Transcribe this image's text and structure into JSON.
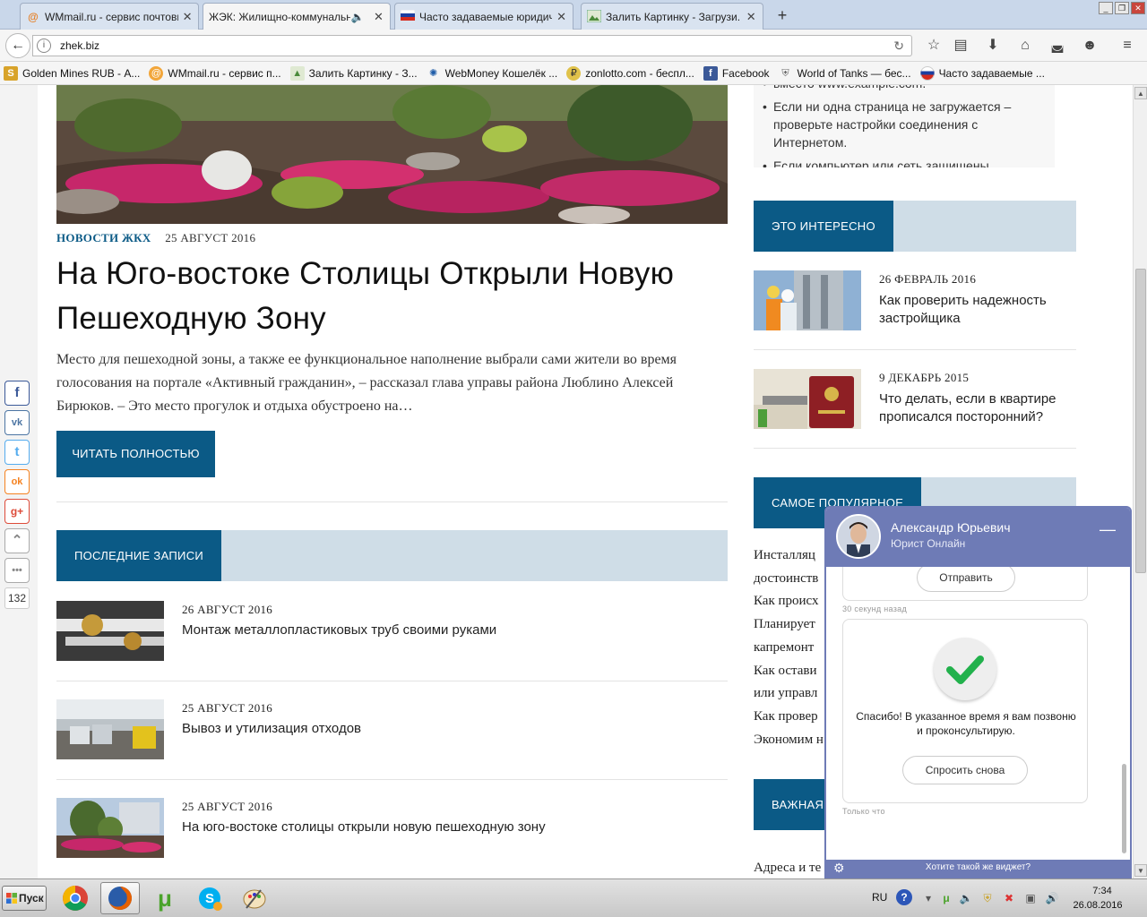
{
  "browser": {
    "tabs": [
      {
        "title": "WMmail.ru - сервис почтовых ...",
        "icon": "wmmail-icon",
        "active": false
      },
      {
        "title": "ЖЭК: Жилищно-коммунальн...",
        "icon": "zhek-icon",
        "active": true
      },
      {
        "title": "Часто задаваемые юридич...",
        "icon": "russia-flag-icon",
        "active": false
      },
      {
        "title": "Залить Картинку - Загрузи...",
        "icon": "image-upload-icon",
        "active": false
      }
    ],
    "new_tab_label": "+",
    "url": "zhek.biz",
    "bookmarks": [
      {
        "label": "Golden Mines RUB - А...",
        "icon": "golden-mines-icon"
      },
      {
        "label": "WMmail.ru - сервис п...",
        "icon": "wmmail-icon"
      },
      {
        "label": "Залить Картинку - З...",
        "icon": "image-upload-icon"
      },
      {
        "label": "WebMoney Кошелёк ...",
        "icon": "webmoney-icon"
      },
      {
        "label": "zonlotto.com - беспл...",
        "icon": "zonlotto-icon"
      },
      {
        "label": "Facebook",
        "icon": "facebook-icon"
      },
      {
        "label": "World of Tanks — бес...",
        "icon": "wot-icon"
      },
      {
        "label": "Часто задаваемые ...",
        "icon": "russia-flag-icon"
      }
    ]
  },
  "share": {
    "buttons": [
      {
        "name": "facebook",
        "glyph": "f",
        "color": "#3b5998"
      },
      {
        "name": "vkontakte",
        "glyph": "vk",
        "color": "#4c75a3"
      },
      {
        "name": "twitter",
        "glyph": "t",
        "color": "#55acee"
      },
      {
        "name": "odnoklassniki",
        "glyph": "ok",
        "color": "#f58220"
      },
      {
        "name": "google-plus",
        "glyph": "g+",
        "color": "#dd4b39"
      },
      {
        "name": "scroll-top",
        "glyph": "⌃",
        "color": "#888888"
      },
      {
        "name": "more",
        "glyph": "•••",
        "color": "#888888"
      }
    ],
    "count": "132"
  },
  "article": {
    "category": "НОВОСТИ ЖКХ",
    "date": "25 АВГУСТ 2016",
    "title": "На Юго-востоке Столицы Открыли Новую Пешеходную Зону",
    "excerpt": "Место для пешеходной зоны, а также ее функциональное наполнение выбрали сами жители во время голосования на портале «Активный гражданин», – рассказал глава управы района Люблино Алексей Бирюков. – Это место прогулок и отдыха обустроено на…",
    "read_more": "ЧИТАТЬ ПОЛНОСТЬЮ"
  },
  "latest": {
    "heading": "ПОСЛЕДНИЕ ЗАПИСИ",
    "posts": [
      {
        "date": "26 АВГУСТ 2016",
        "title": "Монтаж металлопластиковых труб своими руками"
      },
      {
        "date": "25 АВГУСТ 2016",
        "title": "Вывоз и утилизация отходов"
      },
      {
        "date": "25 АВГУСТ 2016",
        "title": "На юго-востоке столицы открыли новую пешеходную зону"
      }
    ]
  },
  "sidebar": {
    "notice_items": [
      "вместо www.example.com.",
      "Если ни одна страница не загружается – проверьте настройки соединения с Интернетом.",
      "Если компьютер или сеть защищены"
    ],
    "interesting_heading": "ЭТО ИНТЕРЕСНО",
    "interesting": [
      {
        "date": "26 ФЕВРАЛЬ 2016",
        "title": "Как проверить надежность застройщика"
      },
      {
        "date": "9 ДЕКАБРЬ 2015",
        "title": "Что делать, если в квартире прописался посторонний?"
      }
    ],
    "popular_heading": "САМОЕ ПОПУЛЯРНОЕ",
    "popular_lines": [
      "Инсталляц",
      "достоинств",
      "Как происх",
      "Планирует",
      "капремонт",
      "Как остави",
      "или управл",
      "Как провер",
      "Экономим н"
    ],
    "important_heading": "ВАЖНАЯ",
    "address_text": "Адреса и те"
  },
  "chat": {
    "name": "Александр Юрьевич",
    "role": "Юрист Онлайн",
    "minimize": "—",
    "send_label": "Отправить",
    "time_1": "30 секунд назад",
    "thanks": "Спасибо! В указанное время я вам позвоню и проконсультирую.",
    "ask_again": "Спросить снова",
    "time_2": "Только что",
    "footer_link": "Хотите такой же виджет?"
  },
  "taskbar": {
    "start_label": "Пуск",
    "apps": [
      {
        "name": "chrome",
        "glyph": "◉",
        "color": "#db4437"
      },
      {
        "name": "firefox",
        "glyph": "◍",
        "color": "#e66000"
      },
      {
        "name": "utorrent",
        "glyph": "μ",
        "color": "#4aa32a"
      },
      {
        "name": "skype",
        "glyph": "S",
        "color": "#00aff0"
      },
      {
        "name": "paint",
        "glyph": "✎",
        "color": "#c9791f"
      }
    ],
    "lang": "RU",
    "time": "7:34",
    "date": "26.08.2016"
  },
  "colors": {
    "brand": "#0b5a86",
    "section_band": "#cfdde7",
    "chat_accent": "#6e7bb6",
    "check_green": "#22b14c"
  }
}
